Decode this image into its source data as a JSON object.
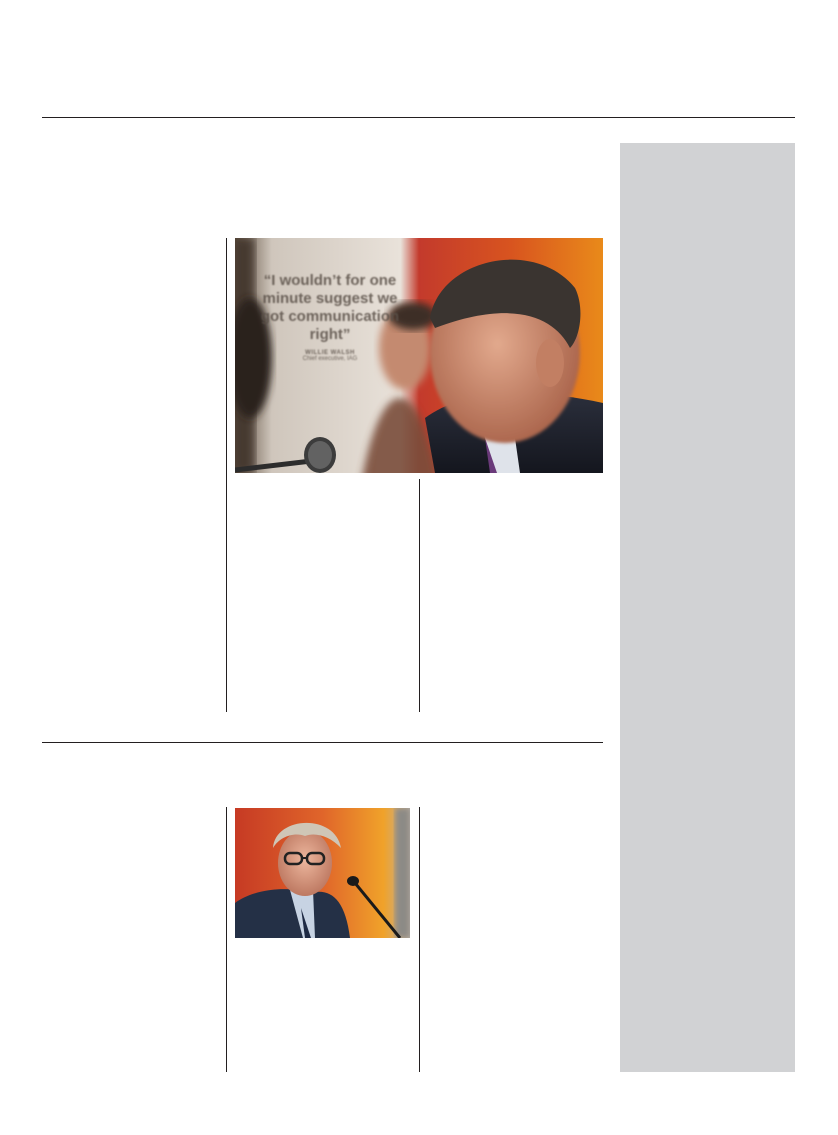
{
  "photo1": {
    "quote_text": "“I wouldn’t for one minute suggest we got communication right”",
    "attribution_name": "WILLIE WALSH",
    "attribution_role": "Chief executive, IAG"
  },
  "colors": {
    "rule": "#231f20",
    "sidebar": "#d1d2d4"
  }
}
